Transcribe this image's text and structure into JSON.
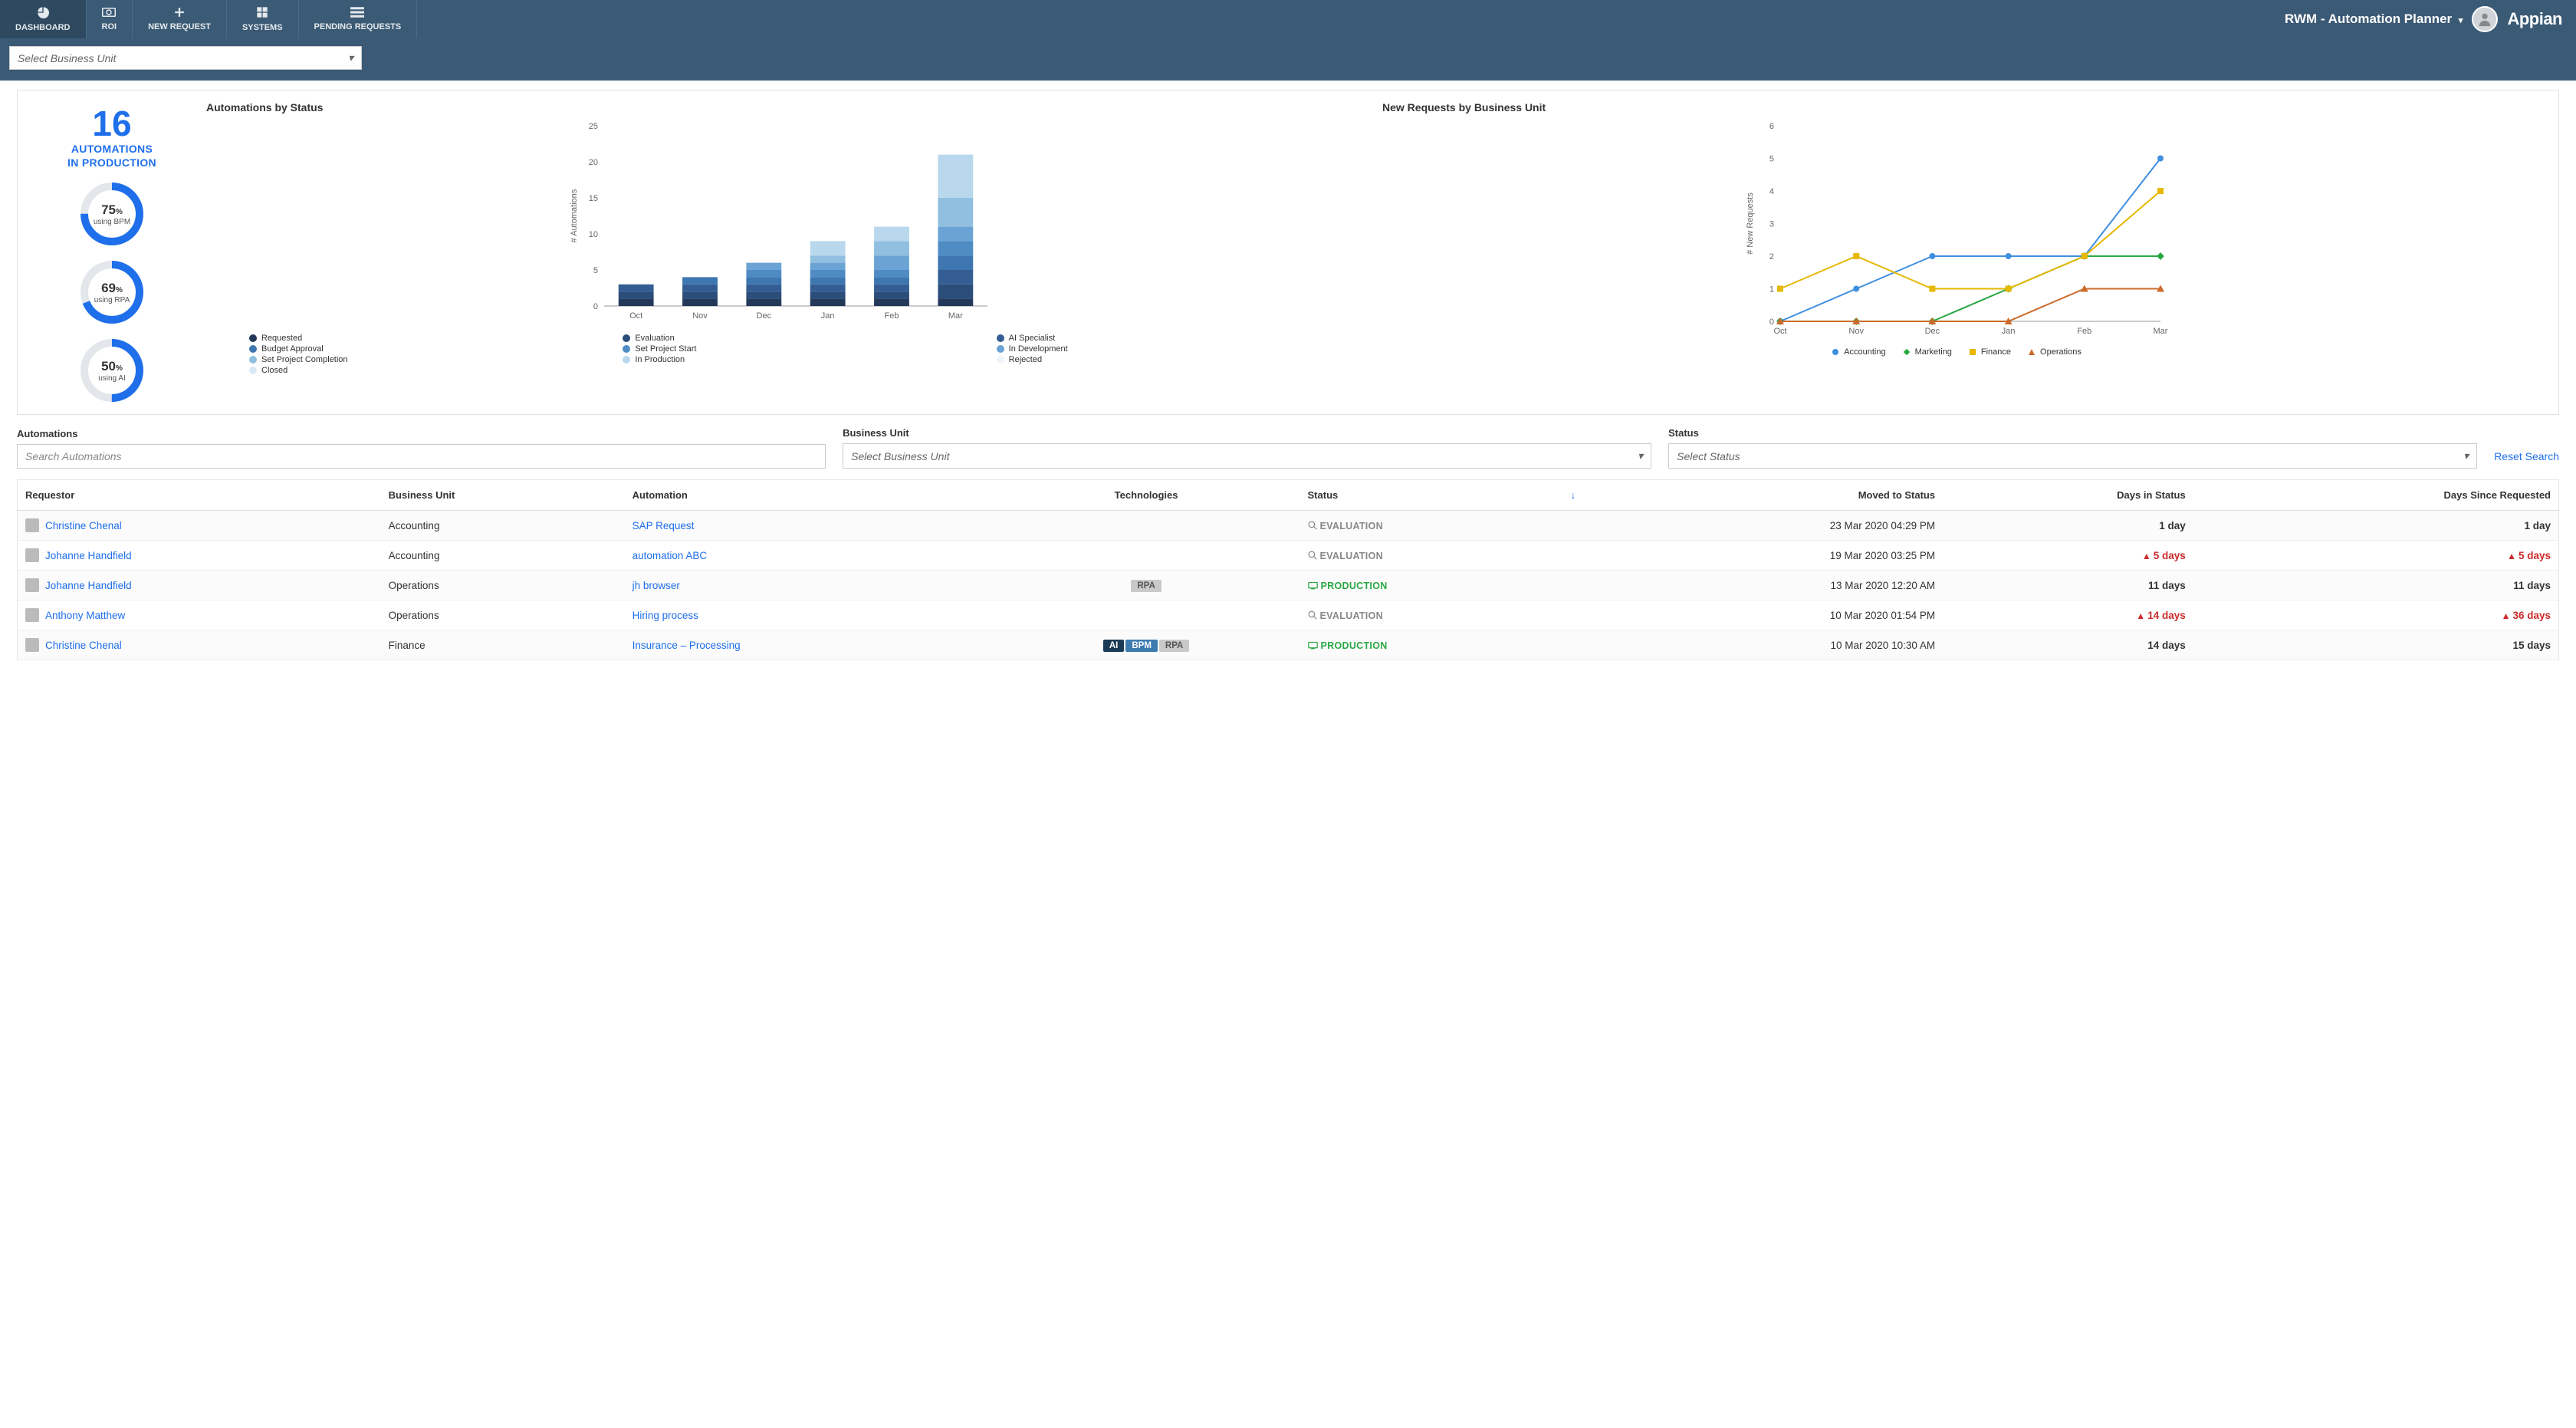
{
  "nav": {
    "tabs": [
      {
        "label": "DASHBOARD",
        "active": true
      },
      {
        "label": "ROI",
        "active": false
      },
      {
        "label": "NEW REQUEST",
        "active": false
      },
      {
        "label": "SYSTEMS",
        "active": false
      },
      {
        "label": "PENDING REQUESTS",
        "active": false
      }
    ],
    "title": "RWM - Automation Planner",
    "brand": "Appian"
  },
  "bu_select_placeholder": "Select Business Unit",
  "kpi": {
    "number": "16",
    "label1": "AUTOMATIONS",
    "label2": "IN PRODUCTION",
    "donuts": [
      {
        "pct": 75,
        "text": "75",
        "sub": "using BPM",
        "color": "#1f6feb"
      },
      {
        "pct": 69,
        "text": "69",
        "sub": "using RPA",
        "color": "#1f6feb"
      },
      {
        "pct": 50,
        "text": "50",
        "sub": "using AI",
        "color": "#1f6feb"
      }
    ]
  },
  "bar_chart_title": "Automations by Status",
  "line_chart_title": "New Requests by Business Unit",
  "bar_ylabel": "# Automations",
  "line_ylabel": "# New Requests",
  "chart_data": [
    {
      "type": "bar",
      "title": "Automations by Status",
      "xlabel": "",
      "ylabel": "# Automations",
      "ylim": [
        0,
        25
      ],
      "categories": [
        "Oct",
        "Nov",
        "Dec",
        "Jan",
        "Feb",
        "Mar"
      ],
      "series": [
        {
          "name": "Requested",
          "color": "#24395a",
          "values": [
            1,
            1,
            1,
            1,
            1,
            1
          ]
        },
        {
          "name": "Evaluation",
          "color": "#2a4d7a",
          "values": [
            1,
            1,
            1,
            1,
            1,
            2
          ]
        },
        {
          "name": "AI Specialist",
          "color": "#345e93",
          "values": [
            1,
            1,
            1,
            1,
            1,
            2
          ]
        },
        {
          "name": "Budget Approval",
          "color": "#3d76b0",
          "values": [
            0,
            1,
            1,
            1,
            1,
            2
          ]
        },
        {
          "name": "Set Project Start",
          "color": "#4f8cc4",
          "values": [
            0,
            0,
            1,
            1,
            1,
            2
          ]
        },
        {
          "name": "In Development",
          "color": "#6ba4d4",
          "values": [
            0,
            0,
            1,
            1,
            2,
            2
          ]
        },
        {
          "name": "Set Project Completion",
          "color": "#90bfe0",
          "values": [
            0,
            0,
            0,
            1,
            2,
            4
          ]
        },
        {
          "name": "In Production",
          "color": "#b9d8ee",
          "values": [
            0,
            0,
            0,
            2,
            2,
            6
          ]
        },
        {
          "name": "Closed",
          "color": "#d9e9f6",
          "values": [
            0,
            0,
            0,
            0,
            0,
            0
          ]
        },
        {
          "name": "Rejected",
          "color": "#eef5fb",
          "values": [
            0,
            0,
            0,
            0,
            0,
            0
          ]
        }
      ],
      "legend_order_display": [
        "Requested",
        "Evaluation",
        "AI Specialist",
        "Budget Approval",
        "Set Project Start",
        "In Development",
        "Set Project Completion",
        "In Production",
        "Rejected",
        "Closed"
      ]
    },
    {
      "type": "line",
      "title": "New Requests by Business Unit",
      "xlabel": "",
      "ylabel": "# New Requests",
      "ylim": [
        0,
        6
      ],
      "categories": [
        "Oct",
        "Nov",
        "Dec",
        "Jan",
        "Feb",
        "Mar"
      ],
      "series": [
        {
          "name": "Accounting",
          "color": "#3f8fe0",
          "values": [
            0,
            1,
            2,
            2,
            2,
            5
          ]
        },
        {
          "name": "Marketing",
          "color": "#2aa744",
          "values": [
            0,
            0,
            0,
            1,
            2,
            2
          ]
        },
        {
          "name": "Finance",
          "color": "#e6b800",
          "values": [
            1,
            2,
            1,
            1,
            2,
            4
          ]
        },
        {
          "name": "Operations",
          "color": "#cc6b2b",
          "values": [
            0,
            0,
            0,
            0,
            1,
            1
          ]
        }
      ]
    }
  ],
  "filters": {
    "automations_label": "Automations",
    "automations_placeholder": "Search Automations",
    "bu_label": "Business Unit",
    "bu_placeholder": "Select Business Unit",
    "status_label": "Status",
    "status_placeholder": "Select Status",
    "reset": "Reset Search"
  },
  "table": {
    "headers": {
      "requestor": "Requestor",
      "bu": "Business Unit",
      "automation": "Automation",
      "tech": "Technologies",
      "status": "Status",
      "moved": "Moved to Status",
      "days_status": "Days in Status",
      "days_req": "Days Since Requested"
    },
    "rows": [
      {
        "requestor": "Christine Chenal",
        "bu": "Accounting",
        "automation": "SAP Request",
        "tech": [],
        "status": "EVALUATION",
        "status_type": "eval",
        "moved": "23 Mar 2020 04:29 PM",
        "days_status": "1 day",
        "days_status_warn": false,
        "days_req": "1 day",
        "days_req_warn": false
      },
      {
        "requestor": "Johanne Handfield",
        "bu": "Accounting",
        "automation": "automation ABC",
        "tech": [],
        "status": "EVALUATION",
        "status_type": "eval",
        "moved": "19 Mar 2020 03:25 PM",
        "days_status": "5 days",
        "days_status_warn": true,
        "days_req": "5 days",
        "days_req_warn": true
      },
      {
        "requestor": "Johanne Handfield",
        "bu": "Operations",
        "automation": "jh browser",
        "tech": [
          "RPA"
        ],
        "status": "PRODUCTION",
        "status_type": "prod",
        "moved": "13 Mar 2020 12:20 AM",
        "days_status": "11 days",
        "days_status_warn": false,
        "days_req": "11 days",
        "days_req_warn": false
      },
      {
        "requestor": "Anthony Matthew",
        "bu": "Operations",
        "automation": "Hiring process",
        "tech": [],
        "status": "EVALUATION",
        "status_type": "eval",
        "moved": "10 Mar 2020 01:54 PM",
        "days_status": "14 days",
        "days_status_warn": true,
        "days_req": "36 days",
        "days_req_warn": true
      },
      {
        "requestor": "Christine Chenal",
        "bu": "Finance",
        "automation": "Insurance – Processing",
        "tech": [
          "AI",
          "BPM",
          "RPA"
        ],
        "status": "PRODUCTION",
        "status_type": "prod",
        "moved": "10 Mar 2020 10:30 AM",
        "days_status": "14 days",
        "days_status_warn": false,
        "days_req": "15 days",
        "days_req_warn": false
      }
    ]
  }
}
